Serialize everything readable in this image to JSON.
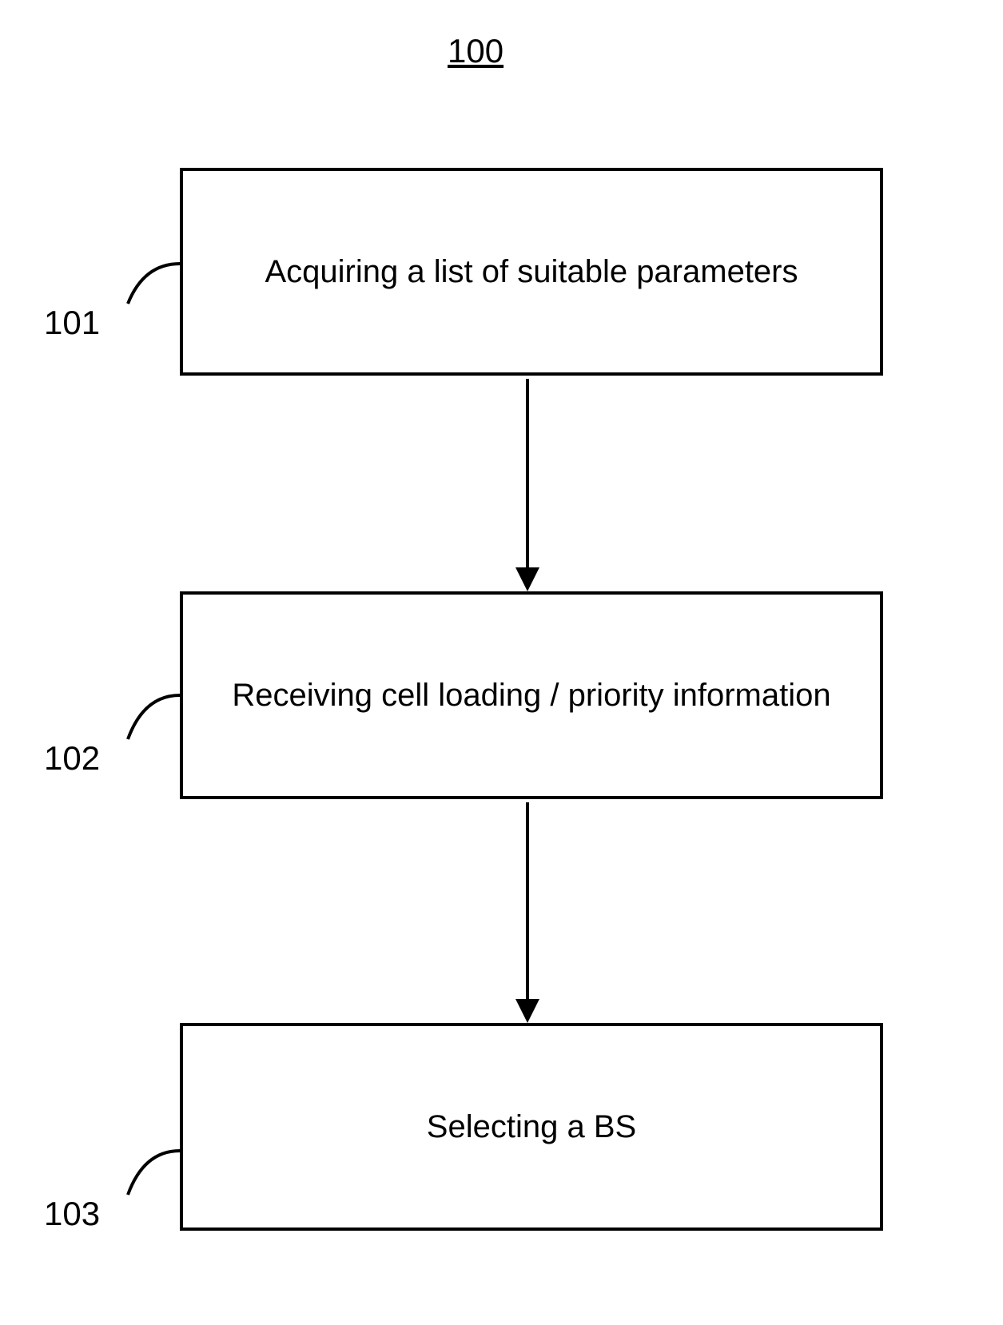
{
  "figure_number": "100",
  "steps": [
    {
      "ref": "101",
      "text": "Acquiring a list of suitable parameters"
    },
    {
      "ref": "102",
      "text": "Receiving cell loading / priority information"
    },
    {
      "ref": "103",
      "text": "Selecting a BS"
    }
  ]
}
